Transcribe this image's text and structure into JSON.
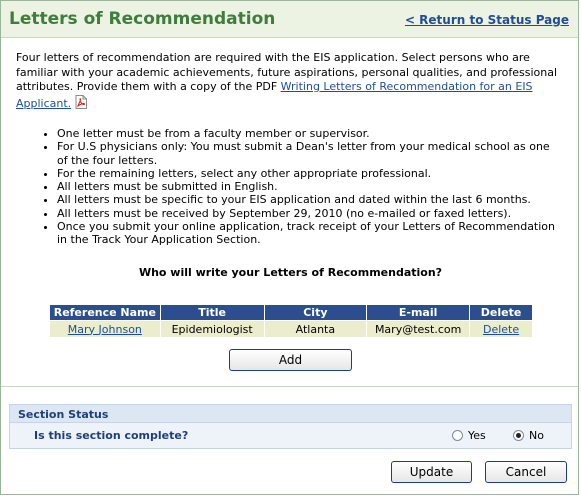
{
  "header": {
    "title": "Letters of Recommendation",
    "return_link": "< Return to Status Page"
  },
  "intro": {
    "text": "Four letters of recommendation are required with the EIS application. Select persons who are familiar with your academic achievements, future aspirations, personal qualities, and professional attributes. Provide them with a copy of the PDF ",
    "link": "Writing Letters of Recommendation for an EIS Applicant.",
    "pdf_icon": "pdf-file-icon"
  },
  "bullets": [
    "One letter must be from a faculty member or supervisor.",
    "For U.S physicians only: You must submit a Dean's letter from your medical school as one of the four letters.",
    "For the remaining letters, select any other appropriate professional.",
    "All letters must be submitted in English.",
    "All letters must be specific to your EIS application and dated within the last 6 months.",
    "All letters must be received by September 29, 2010 (no e-mailed or faxed letters).",
    "Once you submit your online application, track receipt of your Letters of Recommendation in the Track Your Application Section."
  ],
  "question": "Who will write your Letters of Recommendation?",
  "table": {
    "headers": [
      "Reference Name",
      "Title",
      "City",
      "E-mail",
      "Delete"
    ],
    "rows": [
      {
        "name": "Mary Johnson",
        "title": "Epidemiologist",
        "city": "Atlanta",
        "email": "Mary@test.com",
        "delete": "Delete"
      }
    ]
  },
  "add_label": "Add",
  "section_status": {
    "title": "Section Status",
    "question": "Is this section complete?",
    "options": [
      {
        "label": "Yes",
        "checked": false
      },
      {
        "label": "No",
        "checked": true
      }
    ]
  },
  "actions": {
    "update": "Update",
    "cancel": "Cancel"
  },
  "colors": {
    "title_green": "#3f7d3c",
    "header_bg": "#ecf3e3",
    "table_header": "#2d4e8e",
    "table_row": "#ecedcd",
    "link_blue": "#1f4e98"
  }
}
